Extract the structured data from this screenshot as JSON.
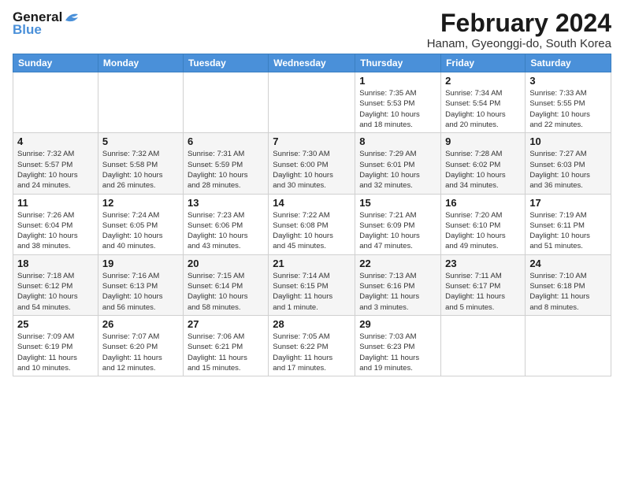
{
  "logo": {
    "line1": "General",
    "line2": "Blue"
  },
  "title": "February 2024",
  "location": "Hanam, Gyeonggi-do, South Korea",
  "days_header": [
    "Sunday",
    "Monday",
    "Tuesday",
    "Wednesday",
    "Thursday",
    "Friday",
    "Saturday"
  ],
  "weeks": [
    [
      {
        "num": "",
        "info": ""
      },
      {
        "num": "",
        "info": ""
      },
      {
        "num": "",
        "info": ""
      },
      {
        "num": "",
        "info": ""
      },
      {
        "num": "1",
        "info": "Sunrise: 7:35 AM\nSunset: 5:53 PM\nDaylight: 10 hours\nand 18 minutes."
      },
      {
        "num": "2",
        "info": "Sunrise: 7:34 AM\nSunset: 5:54 PM\nDaylight: 10 hours\nand 20 minutes."
      },
      {
        "num": "3",
        "info": "Sunrise: 7:33 AM\nSunset: 5:55 PM\nDaylight: 10 hours\nand 22 minutes."
      }
    ],
    [
      {
        "num": "4",
        "info": "Sunrise: 7:32 AM\nSunset: 5:57 PM\nDaylight: 10 hours\nand 24 minutes."
      },
      {
        "num": "5",
        "info": "Sunrise: 7:32 AM\nSunset: 5:58 PM\nDaylight: 10 hours\nand 26 minutes."
      },
      {
        "num": "6",
        "info": "Sunrise: 7:31 AM\nSunset: 5:59 PM\nDaylight: 10 hours\nand 28 minutes."
      },
      {
        "num": "7",
        "info": "Sunrise: 7:30 AM\nSunset: 6:00 PM\nDaylight: 10 hours\nand 30 minutes."
      },
      {
        "num": "8",
        "info": "Sunrise: 7:29 AM\nSunset: 6:01 PM\nDaylight: 10 hours\nand 32 minutes."
      },
      {
        "num": "9",
        "info": "Sunrise: 7:28 AM\nSunset: 6:02 PM\nDaylight: 10 hours\nand 34 minutes."
      },
      {
        "num": "10",
        "info": "Sunrise: 7:27 AM\nSunset: 6:03 PM\nDaylight: 10 hours\nand 36 minutes."
      }
    ],
    [
      {
        "num": "11",
        "info": "Sunrise: 7:26 AM\nSunset: 6:04 PM\nDaylight: 10 hours\nand 38 minutes."
      },
      {
        "num": "12",
        "info": "Sunrise: 7:24 AM\nSunset: 6:05 PM\nDaylight: 10 hours\nand 40 minutes."
      },
      {
        "num": "13",
        "info": "Sunrise: 7:23 AM\nSunset: 6:06 PM\nDaylight: 10 hours\nand 43 minutes."
      },
      {
        "num": "14",
        "info": "Sunrise: 7:22 AM\nSunset: 6:08 PM\nDaylight: 10 hours\nand 45 minutes."
      },
      {
        "num": "15",
        "info": "Sunrise: 7:21 AM\nSunset: 6:09 PM\nDaylight: 10 hours\nand 47 minutes."
      },
      {
        "num": "16",
        "info": "Sunrise: 7:20 AM\nSunset: 6:10 PM\nDaylight: 10 hours\nand 49 minutes."
      },
      {
        "num": "17",
        "info": "Sunrise: 7:19 AM\nSunset: 6:11 PM\nDaylight: 10 hours\nand 51 minutes."
      }
    ],
    [
      {
        "num": "18",
        "info": "Sunrise: 7:18 AM\nSunset: 6:12 PM\nDaylight: 10 hours\nand 54 minutes."
      },
      {
        "num": "19",
        "info": "Sunrise: 7:16 AM\nSunset: 6:13 PM\nDaylight: 10 hours\nand 56 minutes."
      },
      {
        "num": "20",
        "info": "Sunrise: 7:15 AM\nSunset: 6:14 PM\nDaylight: 10 hours\nand 58 minutes."
      },
      {
        "num": "21",
        "info": "Sunrise: 7:14 AM\nSunset: 6:15 PM\nDaylight: 11 hours\nand 1 minute."
      },
      {
        "num": "22",
        "info": "Sunrise: 7:13 AM\nSunset: 6:16 PM\nDaylight: 11 hours\nand 3 minutes."
      },
      {
        "num": "23",
        "info": "Sunrise: 7:11 AM\nSunset: 6:17 PM\nDaylight: 11 hours\nand 5 minutes."
      },
      {
        "num": "24",
        "info": "Sunrise: 7:10 AM\nSunset: 6:18 PM\nDaylight: 11 hours\nand 8 minutes."
      }
    ],
    [
      {
        "num": "25",
        "info": "Sunrise: 7:09 AM\nSunset: 6:19 PM\nDaylight: 11 hours\nand 10 minutes."
      },
      {
        "num": "26",
        "info": "Sunrise: 7:07 AM\nSunset: 6:20 PM\nDaylight: 11 hours\nand 12 minutes."
      },
      {
        "num": "27",
        "info": "Sunrise: 7:06 AM\nSunset: 6:21 PM\nDaylight: 11 hours\nand 15 minutes."
      },
      {
        "num": "28",
        "info": "Sunrise: 7:05 AM\nSunset: 6:22 PM\nDaylight: 11 hours\nand 17 minutes."
      },
      {
        "num": "29",
        "info": "Sunrise: 7:03 AM\nSunset: 6:23 PM\nDaylight: 11 hours\nand 19 minutes."
      },
      {
        "num": "",
        "info": ""
      },
      {
        "num": "",
        "info": ""
      }
    ]
  ]
}
